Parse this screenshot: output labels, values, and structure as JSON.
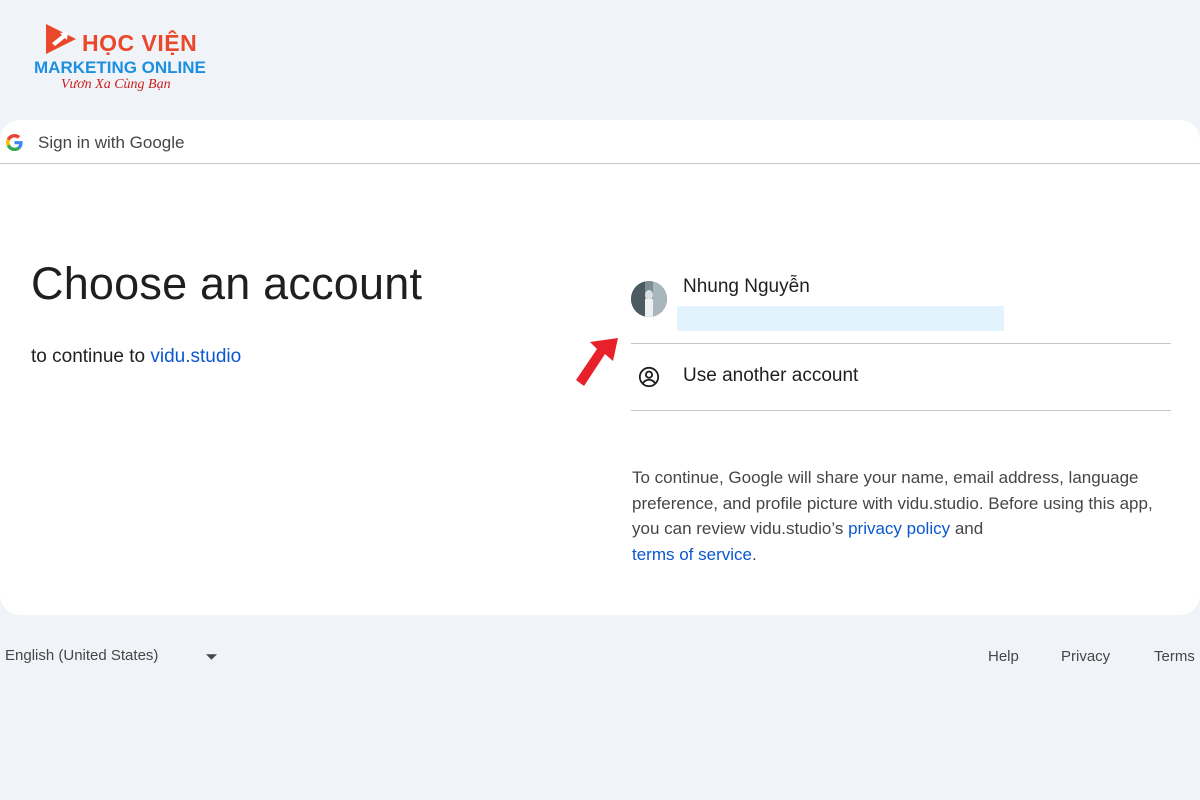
{
  "watermark": {
    "brand_line1": "HỌC VIỆN",
    "brand_line2": "MARKETING ONLINE",
    "brand_line3": "Vươn Xa Cùng Bạn",
    "colors": {
      "orange": "#e9482a",
      "blue": "#1d8fe0",
      "red": "#c8201c"
    }
  },
  "header": {
    "title": "Sign in with Google",
    "icon": "google-g-icon"
  },
  "main": {
    "headline": "Choose an account",
    "subtitle_prefix": "to continue to ",
    "app_name": "vidu.studio"
  },
  "accounts": [
    {
      "name": "Nhung Nguyễn",
      "avatar_icon": "profile-photo"
    }
  ],
  "use_another": {
    "label": "Use another account",
    "icon": "account-circle-icon"
  },
  "disclaimer": {
    "text_part1": "To continue, Google will share your name, email address, language preference, and profile picture with vidu.studio. Before using this app, you can review vidu.studio’s ",
    "privacy_link": "privacy policy",
    "text_part2": " and ",
    "terms_link": "terms of service",
    "text_part3": "."
  },
  "footer": {
    "language": "English (United States)",
    "links": {
      "help": "Help",
      "privacy": "Privacy",
      "terms": "Terms"
    }
  },
  "colors": {
    "page_background": "#f0f4f9",
    "card_background": "#ffffff",
    "link_blue": "#0b57d0",
    "arrow_red": "#e8202a",
    "email_mask": "#e2f3fd"
  }
}
